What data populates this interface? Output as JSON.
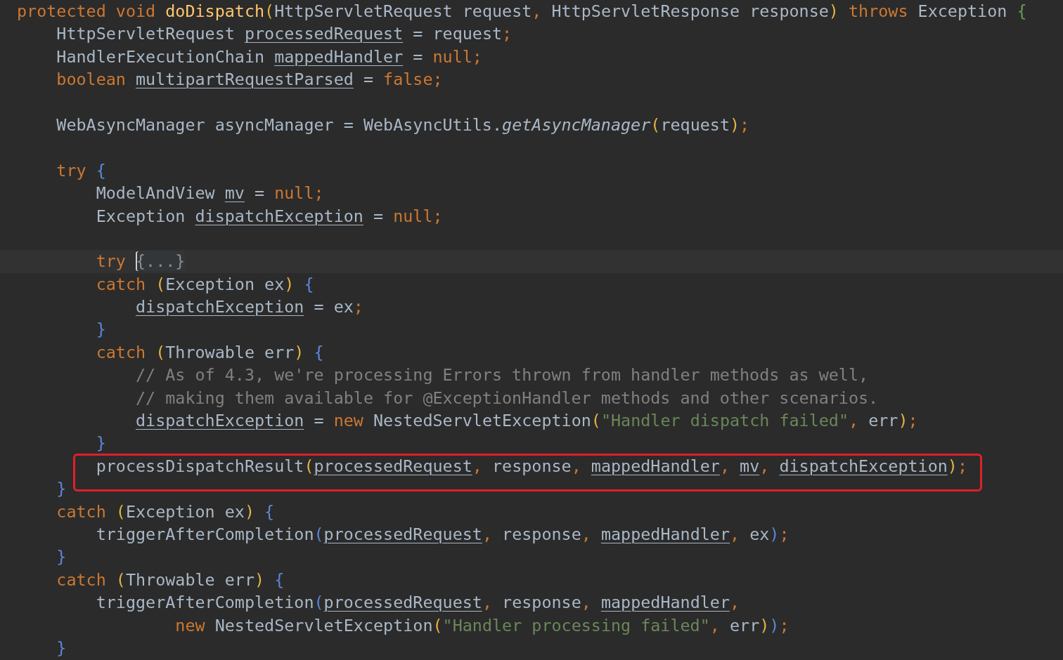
{
  "editor": {
    "lines": [
      {
        "kind": "code",
        "tokens": [
          {
            "kind": "kw",
            "text": "protected void "
          },
          {
            "kind": "decl",
            "text": "doDispatch"
          },
          {
            "kind": "p1",
            "text": "("
          },
          {
            "kind": "plain",
            "text": "HttpServletRequest request"
          },
          {
            "kind": "kw",
            "text": ", "
          },
          {
            "kind": "plain",
            "text": "HttpServletResponse response"
          },
          {
            "kind": "p1",
            "text": ")"
          },
          {
            "kind": "kw",
            "text": " throws"
          },
          {
            "kind": "plain",
            "text": " Exception "
          },
          {
            "kind": "p3",
            "text": "{"
          }
        ]
      },
      {
        "kind": "code",
        "tokens": [
          {
            "kind": "plain",
            "text": "    HttpServletRequest "
          },
          {
            "kind": "var",
            "text": "processedRequest"
          },
          {
            "kind": "plain",
            "text": " = request"
          },
          {
            "kind": "kw",
            "text": ";"
          }
        ]
      },
      {
        "kind": "code",
        "tokens": [
          {
            "kind": "plain",
            "text": "    HandlerExecutionChain "
          },
          {
            "kind": "var",
            "text": "mappedHandler"
          },
          {
            "kind": "plain",
            "text": " = "
          },
          {
            "kind": "kw",
            "text": "null;"
          }
        ]
      },
      {
        "kind": "code",
        "tokens": [
          {
            "kind": "kw",
            "text": "    boolean "
          },
          {
            "kind": "var",
            "text": "multipartRequestParsed"
          },
          {
            "kind": "plain",
            "text": " = "
          },
          {
            "kind": "kw",
            "text": "false;"
          }
        ]
      },
      {
        "kind": "blank"
      },
      {
        "kind": "code",
        "tokens": [
          {
            "kind": "plain",
            "text": "    WebAsyncManager asyncManager = WebAsyncUtils."
          },
          {
            "kind": "italic",
            "text": "getAsyncManager"
          },
          {
            "kind": "p1",
            "text": "("
          },
          {
            "kind": "plain",
            "text": "request"
          },
          {
            "kind": "p1",
            "text": ")"
          },
          {
            "kind": "kw",
            "text": ";"
          }
        ]
      },
      {
        "kind": "blank"
      },
      {
        "kind": "code",
        "tokens": [
          {
            "kind": "kw",
            "text": "    try "
          },
          {
            "kind": "p2",
            "text": "{"
          }
        ]
      },
      {
        "kind": "code",
        "tokens": [
          {
            "kind": "plain",
            "text": "        ModelAndView "
          },
          {
            "kind": "var",
            "text": "mv"
          },
          {
            "kind": "plain",
            "text": " = "
          },
          {
            "kind": "kw",
            "text": "null;"
          }
        ]
      },
      {
        "kind": "code",
        "tokens": [
          {
            "kind": "plain",
            "text": "        Exception "
          },
          {
            "kind": "var",
            "text": "dispatchException"
          },
          {
            "kind": "plain",
            "text": " = "
          },
          {
            "kind": "kw",
            "text": "null;"
          }
        ]
      },
      {
        "kind": "blank"
      },
      {
        "kind": "code",
        "current": true,
        "tokens": [
          {
            "kind": "kw",
            "text": "        try "
          },
          {
            "kind": "fold",
            "text": "{...}",
            "caret": true
          }
        ]
      },
      {
        "kind": "code",
        "tokens": [
          {
            "kind": "kw",
            "text": "        catch "
          },
          {
            "kind": "p1",
            "text": "("
          },
          {
            "kind": "plain",
            "text": "Exception ex"
          },
          {
            "kind": "p1",
            "text": ")"
          },
          {
            "kind": "p2",
            "text": " {"
          }
        ]
      },
      {
        "kind": "code",
        "tokens": [
          {
            "kind": "var",
            "text": "            dispatchException"
          },
          {
            "kind": "plain",
            "text": " = ex"
          },
          {
            "kind": "kw",
            "text": ";"
          }
        ]
      },
      {
        "kind": "code",
        "tokens": [
          {
            "kind": "p2",
            "text": "        }"
          }
        ]
      },
      {
        "kind": "code",
        "tokens": [
          {
            "kind": "kw",
            "text": "        catch "
          },
          {
            "kind": "p1",
            "text": "("
          },
          {
            "kind": "plain",
            "text": "Throwable err"
          },
          {
            "kind": "p1",
            "text": ")"
          },
          {
            "kind": "p2",
            "text": " {"
          }
        ]
      },
      {
        "kind": "code",
        "tokens": [
          {
            "kind": "comment",
            "text": "            // As of 4.3, we're processing Errors thrown from handler methods as well,"
          }
        ]
      },
      {
        "kind": "code",
        "tokens": [
          {
            "kind": "comment",
            "text": "            // making them available for @ExceptionHandler methods and other scenarios."
          }
        ]
      },
      {
        "kind": "code",
        "tokens": [
          {
            "kind": "var",
            "text": "            dispatchException"
          },
          {
            "kind": "plain",
            "text": " = "
          },
          {
            "kind": "kw",
            "text": "new "
          },
          {
            "kind": "plain",
            "text": "NestedServletException"
          },
          {
            "kind": "p1",
            "text": "("
          },
          {
            "kind": "string",
            "text": "\"Handler dispatch failed\""
          },
          {
            "kind": "kw",
            "text": ", "
          },
          {
            "kind": "plain",
            "text": "err"
          },
          {
            "kind": "p1",
            "text": ")"
          },
          {
            "kind": "kw",
            "text": ";"
          }
        ]
      },
      {
        "kind": "code",
        "tokens": [
          {
            "kind": "p2",
            "text": "        }"
          }
        ]
      },
      {
        "kind": "code",
        "outlined": true,
        "tokens": [
          {
            "kind": "plain",
            "text": "        processDispatchResult"
          },
          {
            "kind": "p1",
            "text": "("
          },
          {
            "kind": "var",
            "text": "processedRequest"
          },
          {
            "kind": "kw",
            "text": ", "
          },
          {
            "kind": "plain",
            "text": "response"
          },
          {
            "kind": "kw",
            "text": ", "
          },
          {
            "kind": "var",
            "text": "mappedHandler"
          },
          {
            "kind": "kw",
            "text": ", "
          },
          {
            "kind": "var",
            "text": "mv"
          },
          {
            "kind": "kw",
            "text": ", "
          },
          {
            "kind": "var",
            "text": "dispatchException"
          },
          {
            "kind": "p1",
            "text": ")"
          },
          {
            "kind": "kw",
            "text": ";"
          }
        ]
      },
      {
        "kind": "code",
        "tokens": [
          {
            "kind": "p2",
            "text": "    }"
          }
        ]
      },
      {
        "kind": "code",
        "tokens": [
          {
            "kind": "kw",
            "text": "    catch "
          },
          {
            "kind": "p1",
            "text": "("
          },
          {
            "kind": "plain",
            "text": "Exception ex"
          },
          {
            "kind": "p1",
            "text": ")"
          },
          {
            "kind": "p2",
            "text": " {"
          }
        ]
      },
      {
        "kind": "code",
        "tokens": [
          {
            "kind": "plain",
            "text": "        triggerAfterCompletion"
          },
          {
            "kind": "p2",
            "text": "("
          },
          {
            "kind": "var",
            "text": "processedRequest"
          },
          {
            "kind": "kw",
            "text": ", "
          },
          {
            "kind": "plain",
            "text": "response"
          },
          {
            "kind": "kw",
            "text": ", "
          },
          {
            "kind": "var",
            "text": "mappedHandler"
          },
          {
            "kind": "kw",
            "text": ", "
          },
          {
            "kind": "plain",
            "text": "ex"
          },
          {
            "kind": "p2",
            "text": ")"
          },
          {
            "kind": "kw",
            "text": ";"
          }
        ]
      },
      {
        "kind": "code",
        "tokens": [
          {
            "kind": "p2",
            "text": "    }"
          }
        ]
      },
      {
        "kind": "code",
        "tokens": [
          {
            "kind": "kw",
            "text": "    catch "
          },
          {
            "kind": "p1",
            "text": "("
          },
          {
            "kind": "plain",
            "text": "Throwable err"
          },
          {
            "kind": "p1",
            "text": ")"
          },
          {
            "kind": "p2",
            "text": " {"
          }
        ]
      },
      {
        "kind": "code",
        "tokens": [
          {
            "kind": "plain",
            "text": "        triggerAfterCompletion"
          },
          {
            "kind": "p2",
            "text": "("
          },
          {
            "kind": "var",
            "text": "processedRequest"
          },
          {
            "kind": "kw",
            "text": ", "
          },
          {
            "kind": "plain",
            "text": "response"
          },
          {
            "kind": "kw",
            "text": ", "
          },
          {
            "kind": "var",
            "text": "mappedHandler"
          },
          {
            "kind": "kw",
            "text": ","
          }
        ]
      },
      {
        "kind": "code",
        "tokens": [
          {
            "kind": "kw",
            "text": "                new "
          },
          {
            "kind": "plain",
            "text": "NestedServletException"
          },
          {
            "kind": "p1",
            "text": "("
          },
          {
            "kind": "string",
            "text": "\"Handler processing failed\""
          },
          {
            "kind": "kw",
            "text": ", "
          },
          {
            "kind": "plain",
            "text": "err"
          },
          {
            "kind": "p1",
            "text": ")"
          },
          {
            "kind": "p2",
            "text": ")"
          },
          {
            "kind": "kw",
            "text": ";"
          }
        ]
      },
      {
        "kind": "code",
        "tokens": [
          {
            "kind": "p2",
            "text": "    }"
          }
        ]
      }
    ]
  }
}
